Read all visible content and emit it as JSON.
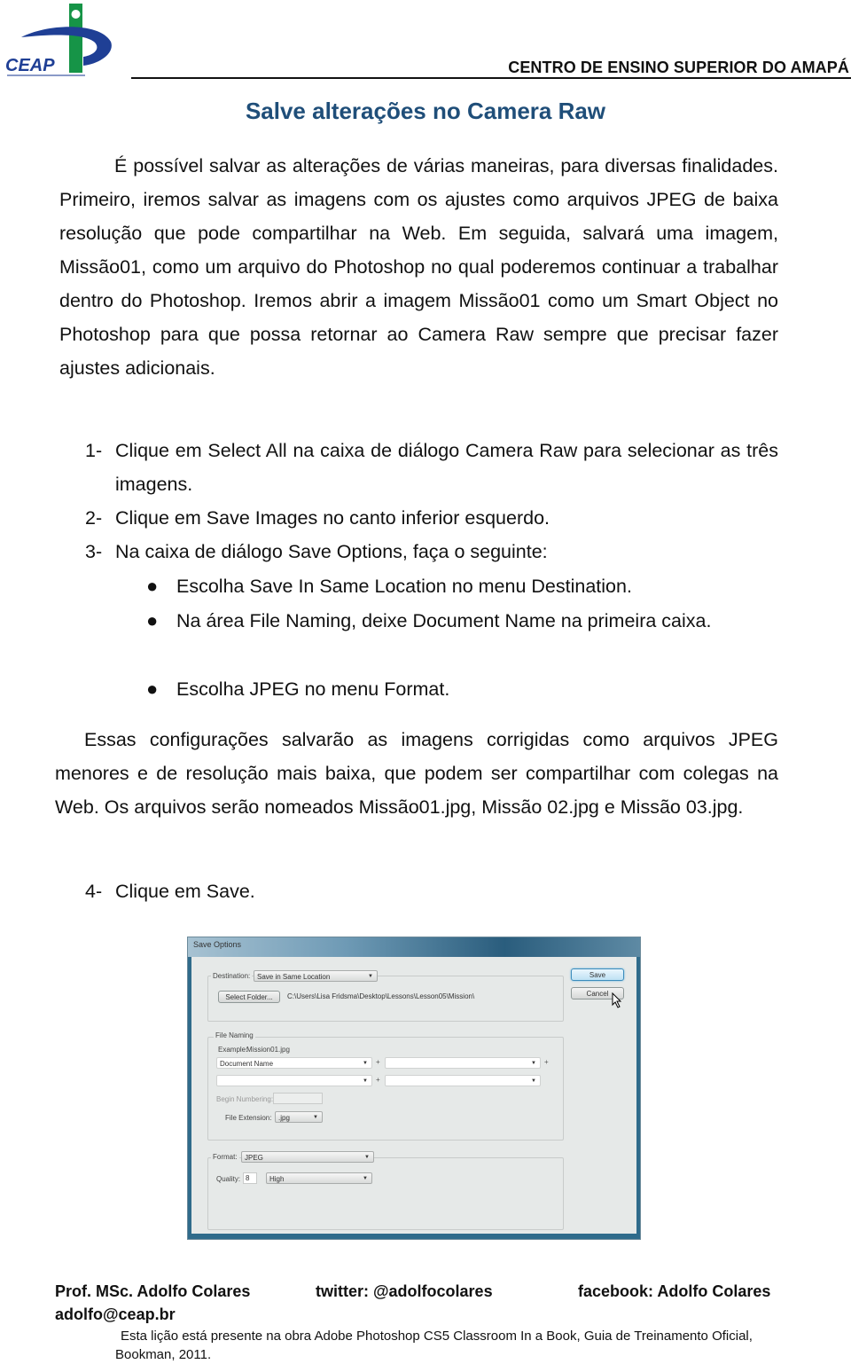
{
  "header": {
    "logo_text": "CEAP",
    "institution": "CENTRO DE ENSINO SUPERIOR DO AMAPÁ"
  },
  "title": "Salve alterações no Camera Raw",
  "intro_paragraph": "É possível salvar as alterações de várias maneiras, para diversas finalidades. Primeiro, iremos salvar as imagens com os ajustes como arquivos JPEG de baixa resolução que pode compartilhar na Web. Em seguida, salvará uma imagem, Missão01, como um arquivo do Photoshop no qual poderemos continuar a trabalhar dentro do Photoshop. Iremos abrir a imagem Missão01 como um Smart Object no Photoshop para que possa retornar ao Camera Raw sempre que precisar fazer ajustes adicionais.",
  "steps": [
    {
      "num": "1-",
      "text": "Clique em Select All na caixa de diálogo Camera Raw para selecionar as três imagens."
    },
    {
      "num": "2-",
      "text": "Clique em Save Images no canto inferior esquerdo."
    },
    {
      "num": "3-",
      "text": "Na caixa de diálogo Save Options, faça o seguinte:"
    },
    {
      "num": "4-",
      "text": "Clique em Save."
    }
  ],
  "bullets": [
    "Escolha Save In Same Location no menu Destination.",
    "Na área File Naming, deixe Document Name na primeira caixa.",
    "Escolha JPEG no menu Format."
  ],
  "result_paragraph": "Essas configurações salvarão as imagens corrigidas como arquivos JPEG menores e de resolução mais baixa, que podem ser compartilhar com colegas na Web. Os arquivos serão nomeados Missão01.jpg, Missão 02.jpg e Missão 03.jpg.",
  "dialog": {
    "title": "Save Options",
    "destination_label": "Destination:",
    "destination_value": "Save in Same Location",
    "select_folder_button": "Select Folder...",
    "folder_path": "C:\\Users\\Lisa Fridsma\\Desktop\\Lessons\\Lesson05\\Mission\\",
    "save_button": "Save",
    "cancel_button": "Cancel",
    "file_naming_legend": "File Naming",
    "example_label": "Example:",
    "example_value": "Mission01.jpg",
    "naming_field_1": "Document Name",
    "naming_field_2": "",
    "naming_field_3": "",
    "naming_field_4": "",
    "begin_numbering_label": "Begin Numbering:",
    "begin_numbering_value": "",
    "file_extension_label": "File Extension:",
    "file_extension_value": ".jpg",
    "format_label": "Format:",
    "format_value": "JPEG",
    "quality_label": "Quality:",
    "quality_value": "8",
    "quality_preset": "High",
    "plus": "+"
  },
  "footer": {
    "name": "Prof. MSc. Adolfo Colares",
    "twitter": "twitter: @adolfocolares",
    "facebook": "facebook: Adolfo Colares",
    "email": "adolfo@ceap.br",
    "note": "Esta lição está presente na obra Adobe Photoshop CS5 Classroom In a Book, Guia de Treinamento Oficial, Bookman, 2011."
  },
  "colors": {
    "title": "#1f4e79",
    "logo_blue": "#1f3f95",
    "logo_green": "#169447"
  }
}
